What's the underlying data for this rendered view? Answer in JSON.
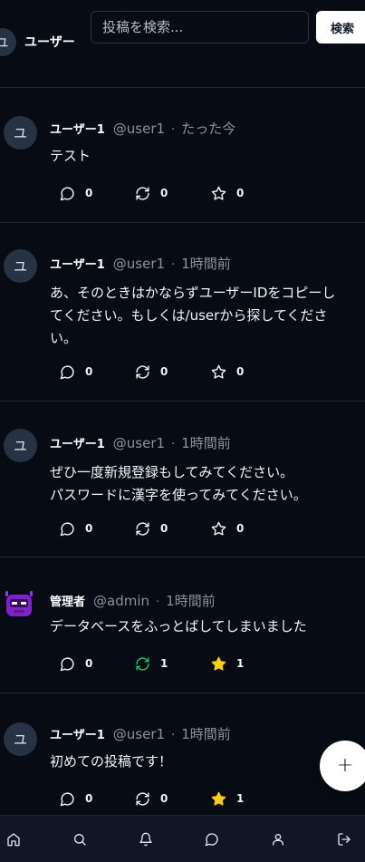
{
  "header": {
    "avatar_initial": "ユ",
    "username": "ユーザー",
    "search_placeholder": "投稿を検索...",
    "search_button": "検索"
  },
  "posts": [
    {
      "avatar_initial": "ユ",
      "avatar_type": "initial",
      "name": "ユーザー1",
      "handle": "@user1",
      "separator": "·",
      "time": "たった今",
      "text": "テスト",
      "replies": "0",
      "reposts": "0",
      "likes": "0",
      "reposted": false,
      "liked": false
    },
    {
      "avatar_initial": "ユ",
      "avatar_type": "initial",
      "name": "ユーザー1",
      "handle": "@user1",
      "separator": "·",
      "time": "1時間前",
      "text": "あ、そのときはかならずユーザーIDをコピーし\nてください。もしくは/userから探してくださ\nい。",
      "replies": "0",
      "reposts": "0",
      "likes": "0",
      "reposted": false,
      "liked": false
    },
    {
      "avatar_initial": "ユ",
      "avatar_type": "initial",
      "name": "ユーザー1",
      "handle": "@user1",
      "separator": "·",
      "time": "1時間前",
      "text": "ぜひ一度新規登録もしてみてください。\nパスワードに漢字を使ってみてください。",
      "replies": "0",
      "reposts": "0",
      "likes": "0",
      "reposted": false,
      "liked": false
    },
    {
      "avatar_type": "robot",
      "name": "管理者",
      "handle": "@admin",
      "separator": "·",
      "time": "1時間前",
      "text": "データベースをふっとばしてしまいました",
      "replies": "0",
      "reposts": "1",
      "likes": "1",
      "reposted": true,
      "liked": true
    },
    {
      "avatar_initial": "ユ",
      "avatar_type": "initial",
      "name": "ユーザー1",
      "handle": "@user1",
      "separator": "·",
      "time": "1時間前",
      "text": "初めての投稿です！",
      "replies": "0",
      "reposts": "0",
      "likes": "1",
      "reposted": false,
      "liked": true
    }
  ],
  "fab": {
    "label": "+"
  },
  "bottom_nav": [
    "home-icon",
    "search-icon",
    "bell-icon",
    "message-icon",
    "user-icon",
    "logout-icon"
  ],
  "colors": {
    "background": "#070b14",
    "repost_active": "#22c55e",
    "like_active": "#facc15",
    "muted": "#8b93a1",
    "nav_background": "#0f1625"
  }
}
